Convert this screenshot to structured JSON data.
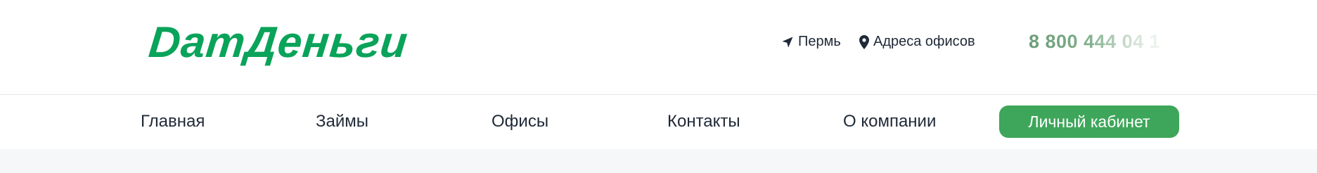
{
  "header": {
    "logo_text": "DamДеньги",
    "city": {
      "icon": "location-arrow-icon",
      "label": "Пермь"
    },
    "offices": {
      "icon": "map-pin-icon",
      "label": "Адреса офисов"
    },
    "phone": "8 800 444 04 1"
  },
  "nav": {
    "items": [
      {
        "label": "Главная"
      },
      {
        "label": "Займы"
      },
      {
        "label": "Офисы"
      },
      {
        "label": "Контакты"
      },
      {
        "label": "О компании"
      }
    ],
    "cabinet_label": "Личный кабинет"
  },
  "colors": {
    "brand_green": "#0aa35a",
    "button_green": "#3ea65a",
    "text_dark": "#1f2937",
    "strip_bg": "#f5f7f9"
  }
}
